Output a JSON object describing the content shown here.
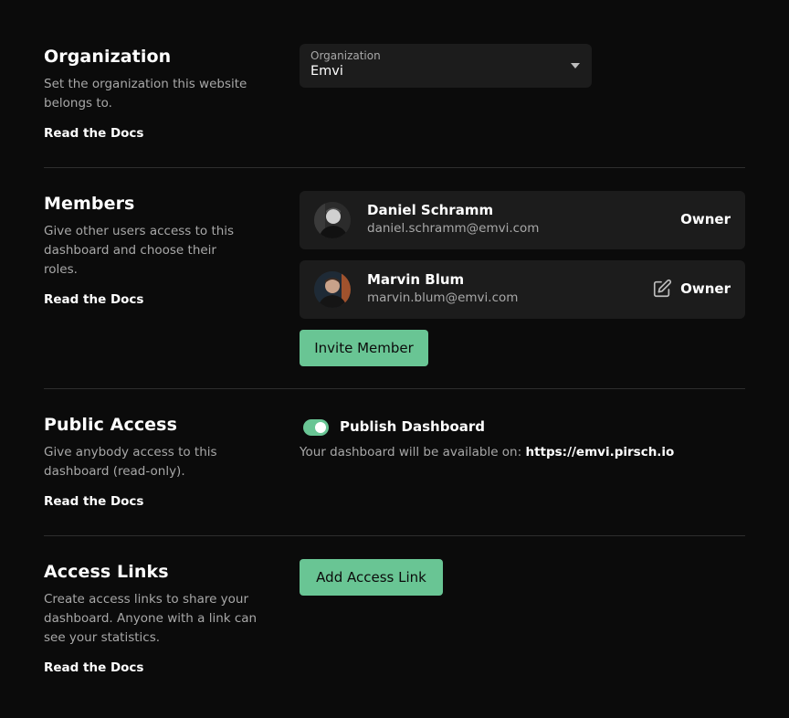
{
  "organization": {
    "title": "Organization",
    "description": "Set the organization this website belongs to.",
    "docs_link": "Read the Docs",
    "select_label": "Organization",
    "select_value": "Emvi"
  },
  "members": {
    "title": "Members",
    "description": "Give other users access to this dashboard and choose their roles.",
    "docs_link": "Read the Docs",
    "list": [
      {
        "name": "Daniel Schramm",
        "email": "daniel.schramm@emvi.com",
        "role": "Owner"
      },
      {
        "name": "Marvin Blum",
        "email": "marvin.blum@emvi.com",
        "role": "Owner"
      }
    ],
    "invite_button": "Invite Member"
  },
  "public_access": {
    "title": "Public Access",
    "description": "Give anybody access to this dashboard (read-only).",
    "docs_link": "Read the Docs",
    "toggle_label": "Publish Dashboard",
    "toggle_on": true,
    "availability_text": "Your dashboard will be available on: ",
    "url": "https://emvi.pirsch.io"
  },
  "access_links": {
    "title": "Access Links",
    "description": "Create access links to share your dashboard. Anyone with a link can see your statistics.",
    "docs_link": "Read the Docs",
    "add_button": "Add Access Link"
  },
  "colors": {
    "accent": "#69c594",
    "background": "#0b0b0b",
    "card": "#1c1c1c",
    "muted_text": "#a8a8a8"
  }
}
